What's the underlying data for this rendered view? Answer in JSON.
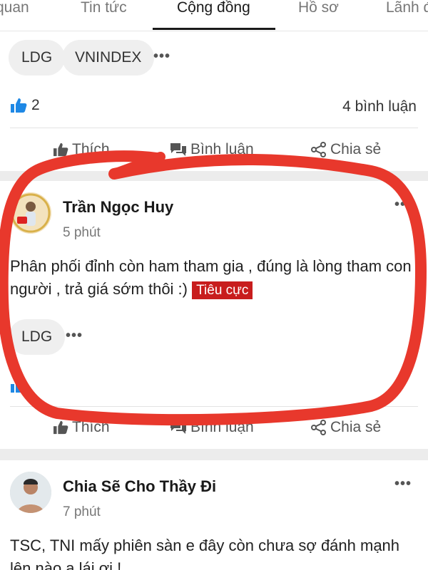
{
  "tabs": [
    "quan",
    "Tin tức",
    "Cộng đồng",
    "Hồ sơ",
    "Lãnh đ"
  ],
  "active_tab": "Cộng đồng",
  "colors": {
    "annotation": "#e8382c",
    "negative_tag": "#c81d1d",
    "like_icon": "#1e88e5"
  },
  "posts": [
    {
      "tags": [
        "LDG",
        "VNINDEX"
      ],
      "likes": "2",
      "comments": "4 bình luận",
      "actions": {
        "like": "Thích",
        "comment": "Bình luận",
        "share": "Chia sẻ"
      }
    },
    {
      "author": "Trần Ngọc Huy",
      "time": "5 phút",
      "text": "Phân phối đỉnh còn ham tham gia , đúng là lòng tham con người , trả giá sớm thôi :)",
      "sentiment": "Tiêu cực",
      "tags": [
        "LDG"
      ],
      "actions": {
        "like": "Thích",
        "comment": "Bình luận",
        "share": "Chia sẻ"
      }
    },
    {
      "author": "Chia Sẽ Cho Thầy Đi",
      "time": "7 phút",
      "text": "TSC, TNI mấy phiên sàn e đây còn chưa sợ đánh mạnh lên nào a lái ơi !"
    }
  ]
}
